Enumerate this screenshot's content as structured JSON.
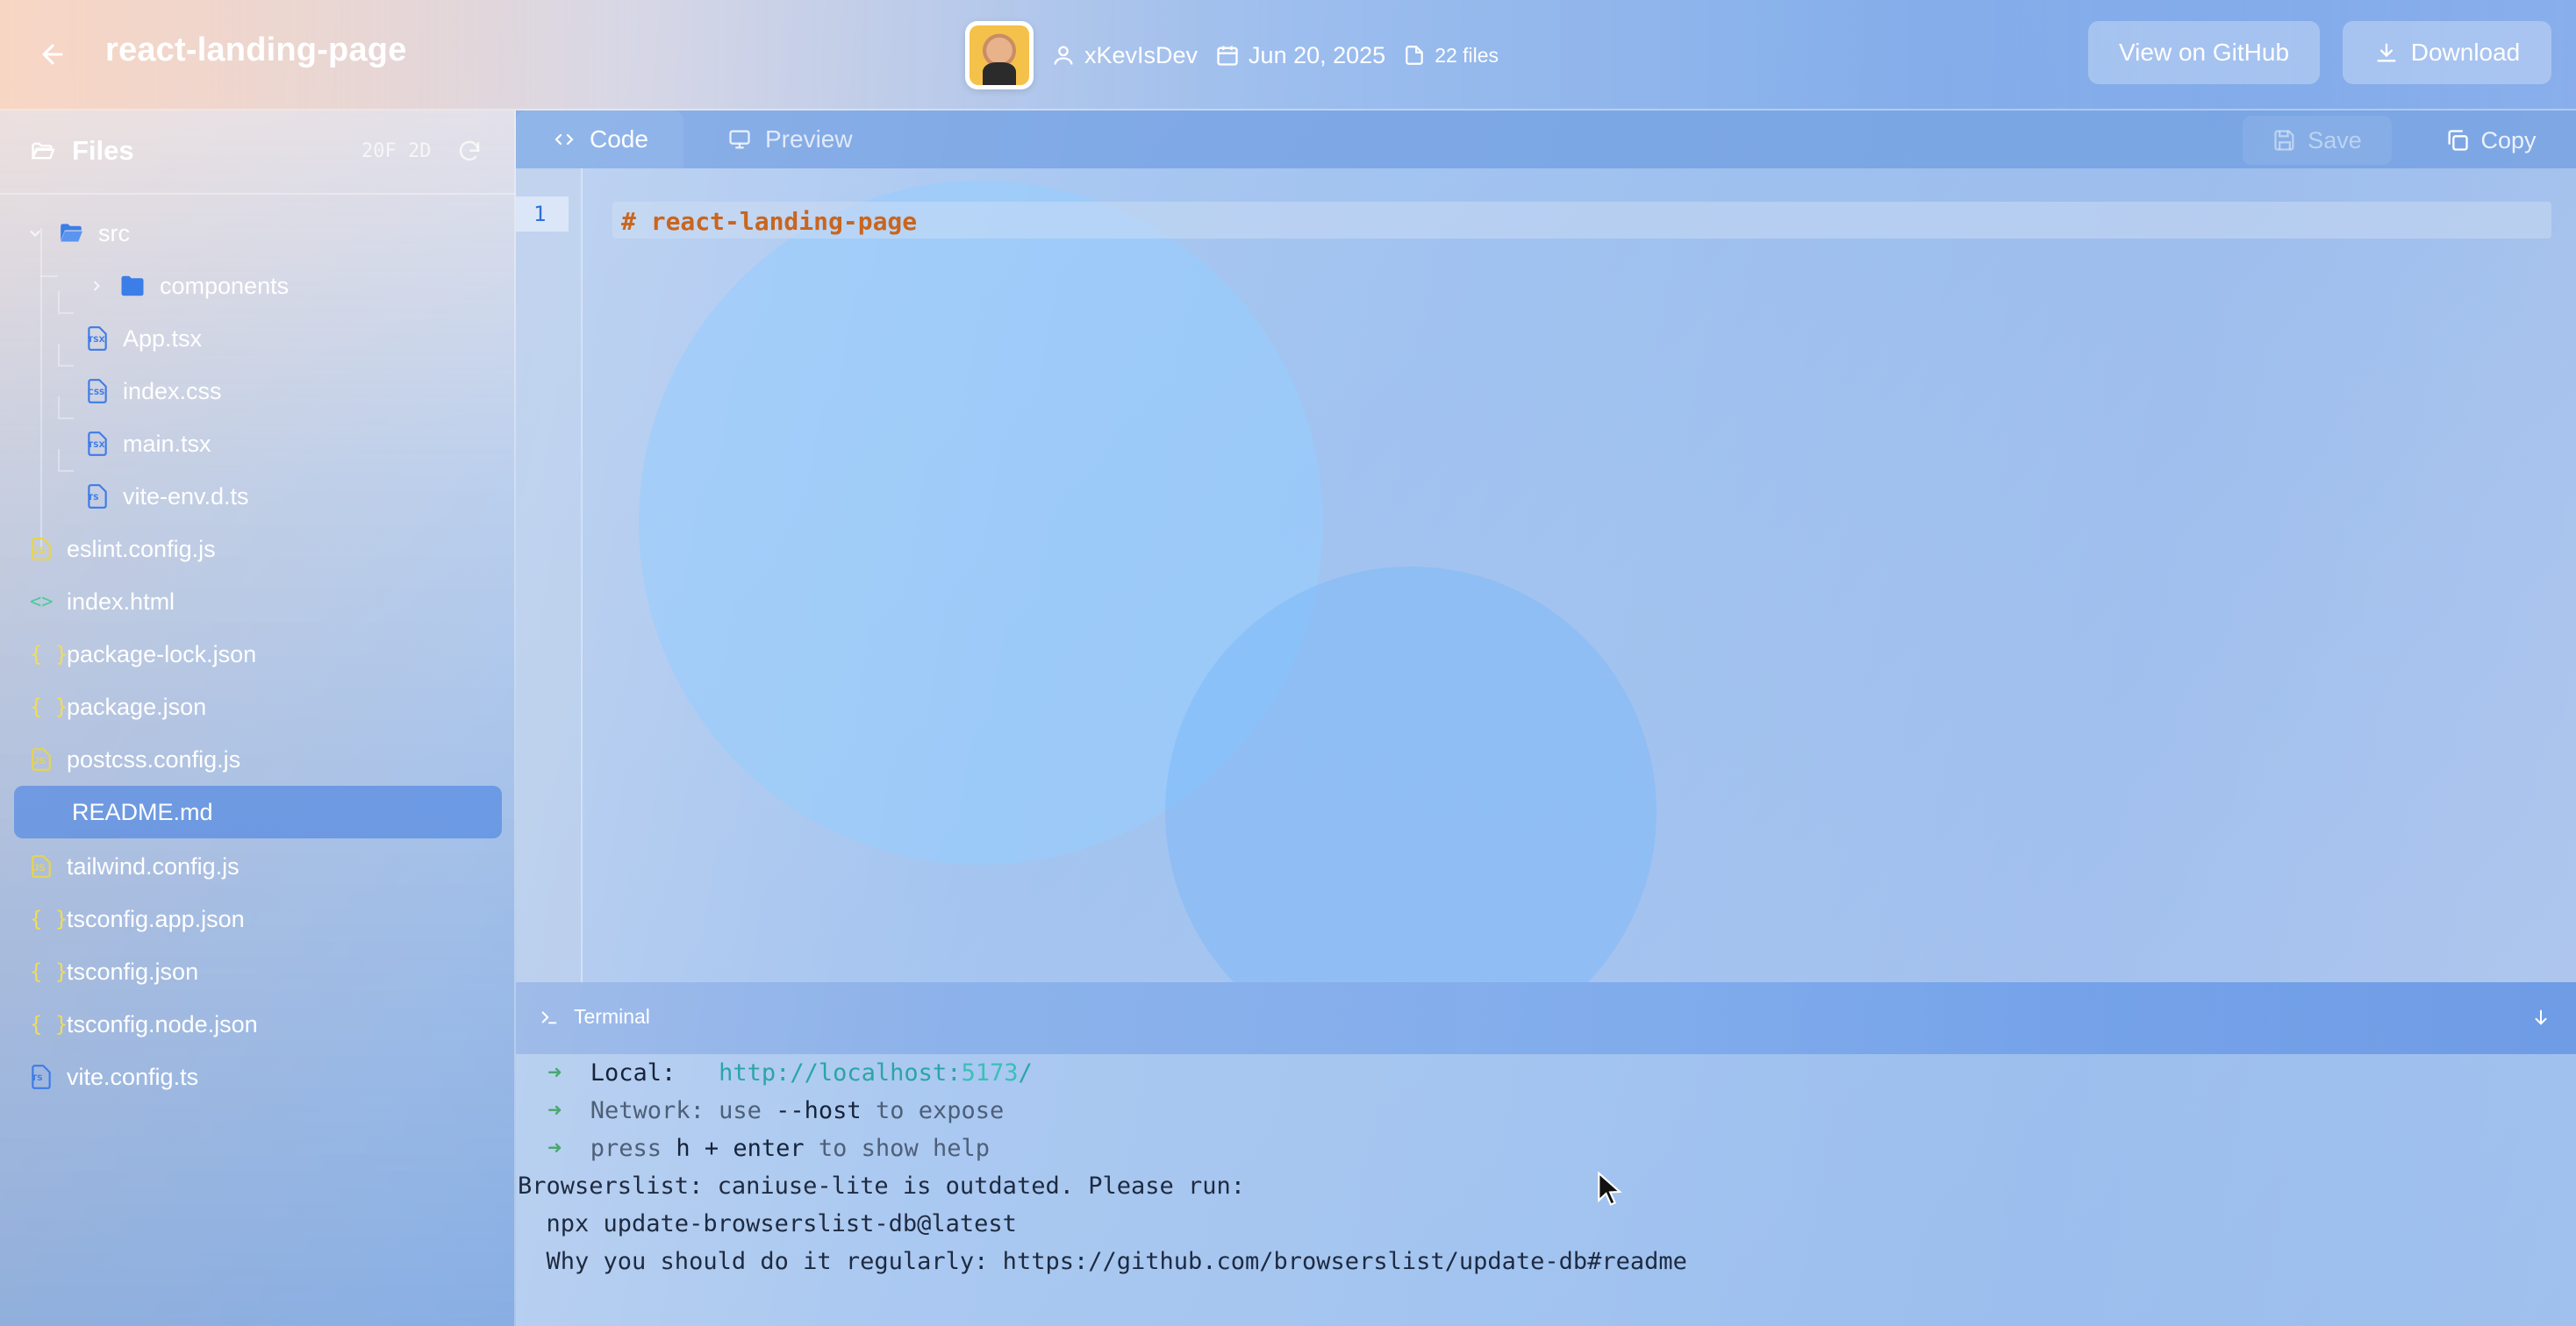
{
  "header": {
    "title": "react-landing-page",
    "author": "xKevIsDev",
    "date": "Jun 20, 2025",
    "file_count": "22 files",
    "github_label": "View on GitHub",
    "download_label": "Download"
  },
  "sidebar": {
    "title": "Files",
    "counts": "20F 2D",
    "tree": [
      {
        "label": "src",
        "type": "folder-open"
      },
      {
        "label": "components",
        "type": "folder"
      },
      {
        "label": "App.tsx",
        "type": "tsx"
      },
      {
        "label": "index.css",
        "type": "css"
      },
      {
        "label": "main.tsx",
        "type": "tsx"
      },
      {
        "label": "vite-env.d.ts",
        "type": "ts"
      },
      {
        "label": "eslint.config.js",
        "type": "js"
      },
      {
        "label": "index.html",
        "type": "html"
      },
      {
        "label": "package-lock.json",
        "type": "json"
      },
      {
        "label": "package.json",
        "type": "json"
      },
      {
        "label": "postcss.config.js",
        "type": "js"
      },
      {
        "label": "README.md",
        "type": "md",
        "selected": true
      },
      {
        "label": "tailwind.config.js",
        "type": "js"
      },
      {
        "label": "tsconfig.app.json",
        "type": "json"
      },
      {
        "label": "tsconfig.json",
        "type": "json"
      },
      {
        "label": "tsconfig.node.json",
        "type": "json"
      },
      {
        "label": "vite.config.ts",
        "type": "ts"
      }
    ],
    "badges": {
      "tsx": "TSX",
      "css": "CSS",
      "ts": "TS",
      "js": "JS"
    }
  },
  "editor": {
    "tabs": {
      "code": "Code",
      "preview": "Preview"
    },
    "save_label": "Save",
    "copy_label": "Copy",
    "line_number": "1",
    "code": "# react-landing-page"
  },
  "terminal": {
    "label": "Terminal",
    "arrow": "➜",
    "local_label": "Local:",
    "local_url_base": "http://localhost:",
    "local_url_port": "5173",
    "local_url_slash": "/",
    "network_label": "Network:",
    "network_use": "use",
    "network_flag": "--host",
    "network_tail": "to expose",
    "help_press": "press",
    "help_keys": "h + enter",
    "help_tail": "to show help",
    "browserslist_1": "Browserslist: caniuse-lite is outdated. Please run:",
    "browserslist_2": "  npx update-browserslist-db@latest",
    "browserslist_3": "  Why you should do it regularly: https://github.com/browserslist/update-db#readme"
  },
  "colors": {
    "selected_row": "#5a8ce1",
    "code_text": "#c9651e",
    "url_text": "#2aa5a5",
    "icon_json": "#f2dc55",
    "icon_html": "#4fc99a",
    "icon_ts": "#3e7be6"
  }
}
